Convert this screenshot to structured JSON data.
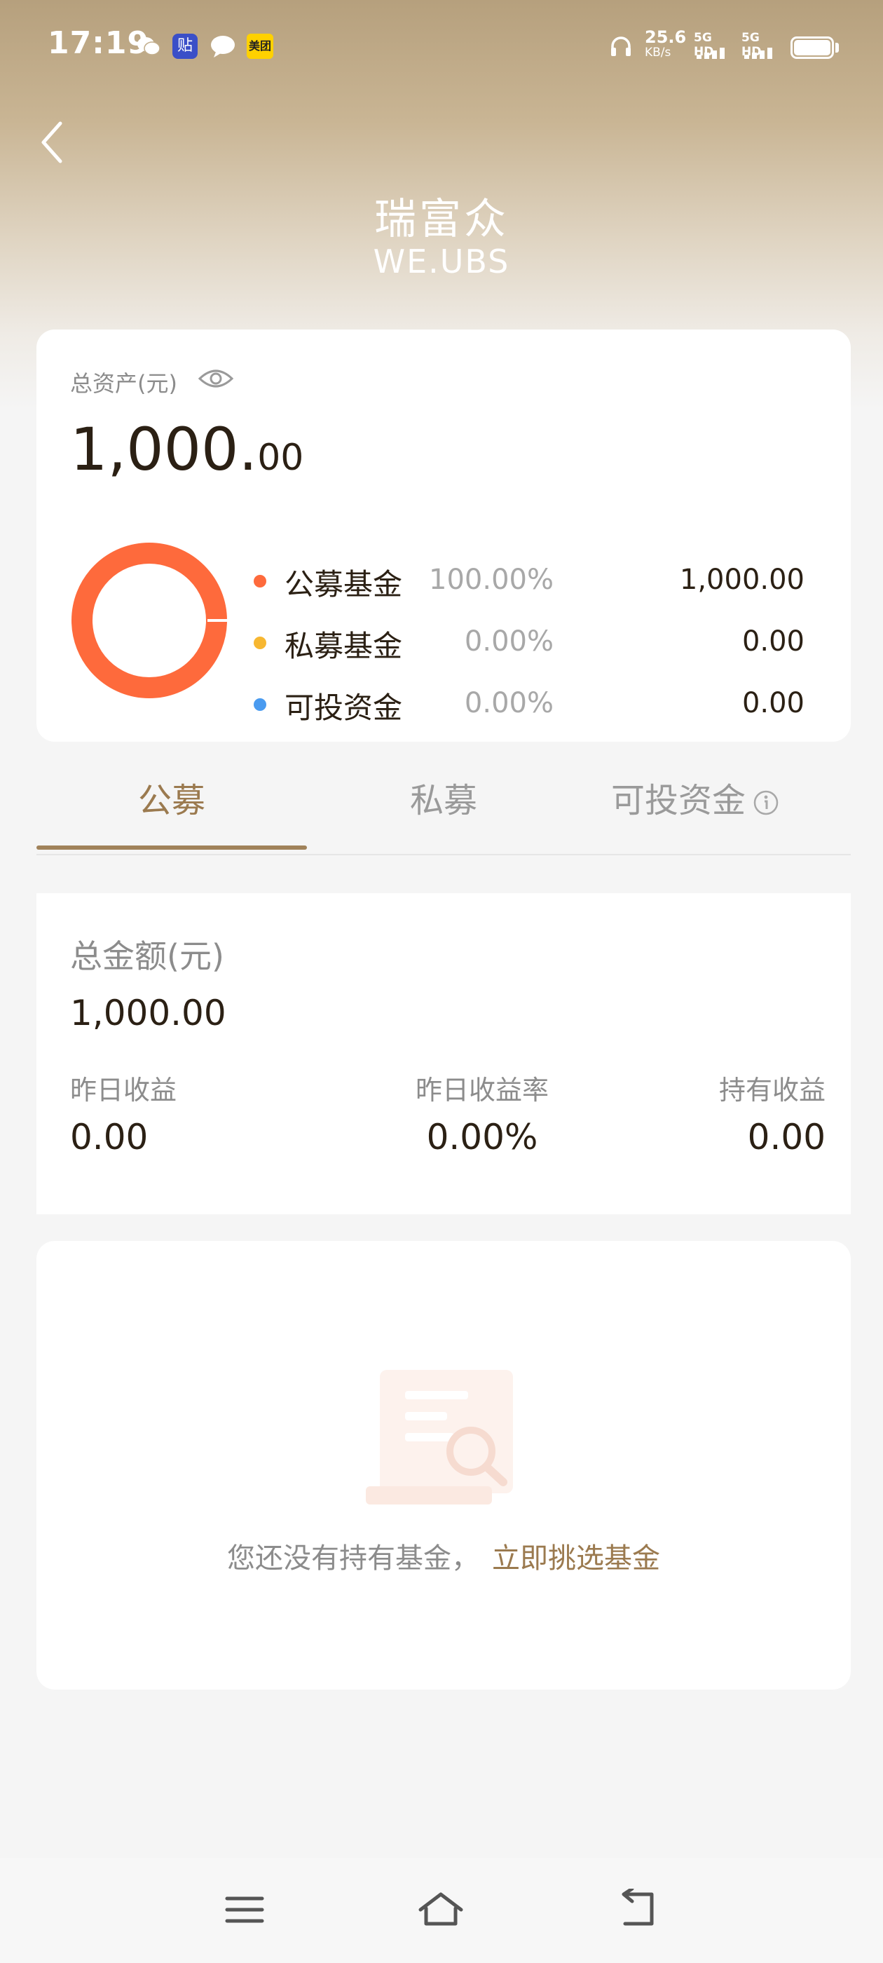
{
  "status_bar": {
    "time": "17:19",
    "net_speed": "25.6",
    "net_unit": "KB/s",
    "sim1": "5G HD",
    "sim2": "5G HD",
    "tie_badge": "贴",
    "meituan_badge": "美团"
  },
  "header": {
    "logo_cn": "瑞富众",
    "logo_en": "WE.UBS"
  },
  "asset_card": {
    "label": "总资产(元)",
    "total_int": "1,000.",
    "total_dec": "00",
    "allocation": [
      {
        "name": "公募基金",
        "percent": "100.00%",
        "value": "1,000.00",
        "color": "#fe6a3c",
        "share": 1.0
      },
      {
        "name": "私募基金",
        "percent": "0.00%",
        "value": "0.00",
        "color": "#f7b731",
        "share": 0.0
      },
      {
        "name": "可投资金",
        "percent": "0.00%",
        "value": "0.00",
        "color": "#4a9bf0",
        "share": 0.0
      }
    ]
  },
  "tabs": [
    {
      "label": "公募",
      "active": true
    },
    {
      "label": "私募",
      "active": false
    },
    {
      "label": "可投资金",
      "active": false
    }
  ],
  "summary": {
    "label": "总金额(元)",
    "total": "1,000.00",
    "stats": [
      {
        "label": "昨日收益",
        "value": "0.00"
      },
      {
        "label": "昨日收益率",
        "value": "0.00%"
      },
      {
        "label": "持有收益",
        "value": "0.00"
      }
    ]
  },
  "empty_state": {
    "text": "您还没有持有基金，",
    "link": "立即挑选基金"
  },
  "colors": {
    "accent": "#9b7a4f",
    "donut": "#fe6a3c"
  }
}
